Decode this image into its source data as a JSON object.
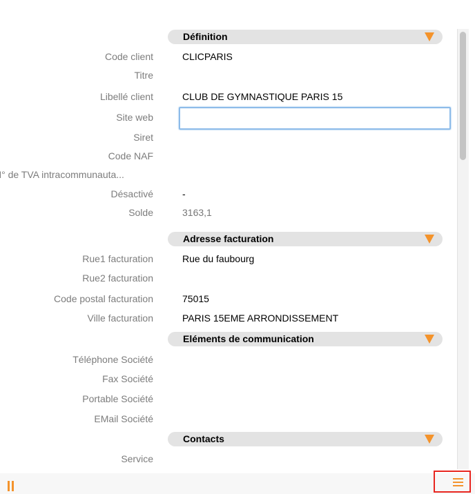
{
  "form": {
    "sections": {
      "definition": "Définition",
      "billing_address": "Adresse facturation",
      "communication": "Eléments de communication",
      "contacts": "Contacts"
    },
    "fields": {
      "code_client": {
        "label": "Code client",
        "value": "CLICPARIS"
      },
      "titre": {
        "label": "Titre",
        "value": ""
      },
      "libelle_client": {
        "label": "Libellé client",
        "value": "CLUB DE GYMNASTIQUE PARIS 15"
      },
      "site_web": {
        "label": "Site web",
        "value": ""
      },
      "siret": {
        "label": "Siret",
        "value": ""
      },
      "code_naf": {
        "label": "Code NAF",
        "value": ""
      },
      "tva": {
        "label": "N° de TVA intracommunauta...",
        "value": ""
      },
      "desactive": {
        "label": "Désactivé",
        "value": "-"
      },
      "solde": {
        "label": "Solde",
        "value": "3163,1"
      },
      "rue1": {
        "label": "Rue1 facturation",
        "value": "Rue du faubourg"
      },
      "rue2": {
        "label": "Rue2 facturation",
        "value": ""
      },
      "code_postal": {
        "label": "Code postal facturation",
        "value": "75015"
      },
      "ville": {
        "label": "Ville facturation",
        "value": "PARIS 15EME ARRONDISSEMENT"
      },
      "telephone": {
        "label": "Téléphone Société",
        "value": ""
      },
      "fax": {
        "label": "Fax Société",
        "value": ""
      },
      "portable": {
        "label": "Portable Société",
        "value": ""
      },
      "email": {
        "label": "EMail Société",
        "value": ""
      },
      "service": {
        "label": "Service",
        "value": ""
      }
    }
  },
  "icons": {
    "collapse": "collapse-triangle-icon",
    "pause": "pause-icon",
    "menu": "menu-icon"
  },
  "colors": {
    "accent": "#f4932b",
    "section_bg": "#e3e3e3",
    "label": "#7c7c7c",
    "focus": "#8cbbe9",
    "highlight": "#e8251f"
  }
}
